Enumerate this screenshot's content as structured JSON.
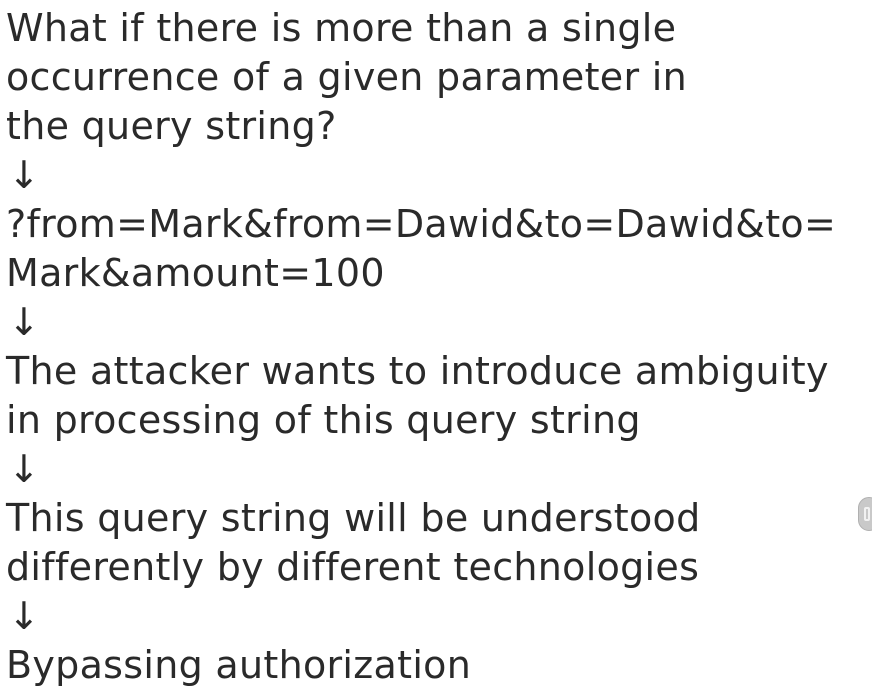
{
  "slide": {
    "question_lines": [
      "What if there is more than a single",
      "occurrence of a given parameter in",
      "the query string?"
    ],
    "arrow": "↓",
    "query_lines": [
      "?from=Mark&from=Dawid&to=Dawid&to=",
      "Mark&amount=100"
    ],
    "attacker_lines": [
      "The attacker wants to introduce ambiguity",
      "in processing of this query string"
    ],
    "understood_lines": [
      "This query string will be understood",
      "differently by different technologies"
    ],
    "result_line": "Bypassing authorization"
  }
}
